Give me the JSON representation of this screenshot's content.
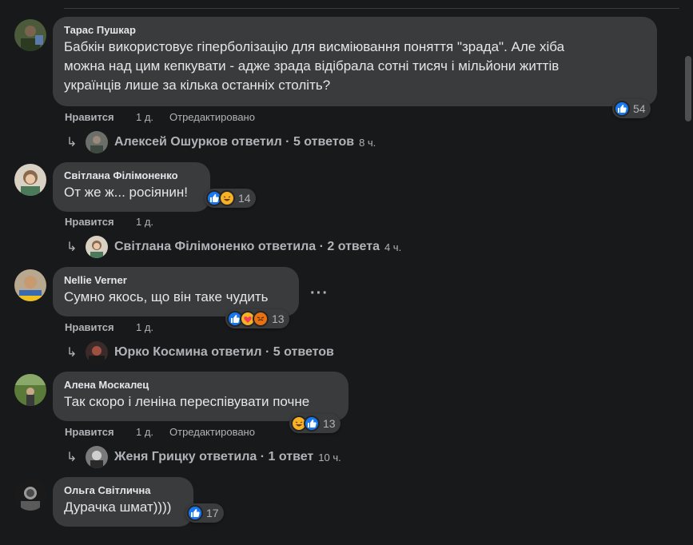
{
  "colors": {
    "background": "#18191a",
    "bubble": "#3a3b3c",
    "text": "#e4e6eb",
    "muted": "#b0b3b8",
    "like_blue": "#1877f2"
  },
  "comments": [
    {
      "author": "Тарас Пушкар",
      "text_lines": [
        "Бабкін використовує гіперболізацію для висміювання поняття \"зрада\". Але хіба",
        "можна над цим кепкувати - адже зрада відібрала сотні тисяч і мільйони життів",
        "українців лише за кілька останніх століть?"
      ],
      "like_label": "Нравится",
      "time": "1 д.",
      "edited": "Отредактировано",
      "reactions": [
        "like-icon"
      ],
      "reaction_count": "54",
      "reply_author_text": "Алексей Ошурков ответил · 5 ответов",
      "reply_time": "8 ч."
    },
    {
      "author": "Світлана Філімоненко",
      "text_lines": [
        "От же ж... росіянин!"
      ],
      "like_label": "Нравится",
      "time": "1 д.",
      "reactions": [
        "like-icon",
        "haha-icon"
      ],
      "reaction_count": "14",
      "reply_author_text": "Світлана Філімоненко ответила · 2 ответа",
      "reply_time": "4 ч."
    },
    {
      "author": "Nellie Verner",
      "text_lines": [
        "Сумно якось, що він таке чудить"
      ],
      "like_label": "Нравится",
      "time": "1 д.",
      "reactions": [
        "like-icon",
        "care-icon",
        "angry-icon"
      ],
      "reaction_count": "13",
      "reply_author_text": "Юрко Космина ответил · 5 ответов",
      "reply_time": ""
    },
    {
      "author": "Алена Москалец",
      "text_lines": [
        "Так скоро і леніна переспівувати почне"
      ],
      "like_label": "Нравится",
      "time": "1 д.",
      "edited": "Отредактировано",
      "reactions": [
        "haha-icon",
        "like-icon"
      ],
      "reaction_count": "13",
      "reply_author_text": "Женя Грицку ответила · 1 ответ",
      "reply_time": "10 ч."
    },
    {
      "author": "Ольга Світлична",
      "text_lines": [
        "Дурачка шмат))))"
      ],
      "reactions": [
        "like-icon"
      ],
      "reaction_count": "17"
    }
  ],
  "more_options": "···"
}
